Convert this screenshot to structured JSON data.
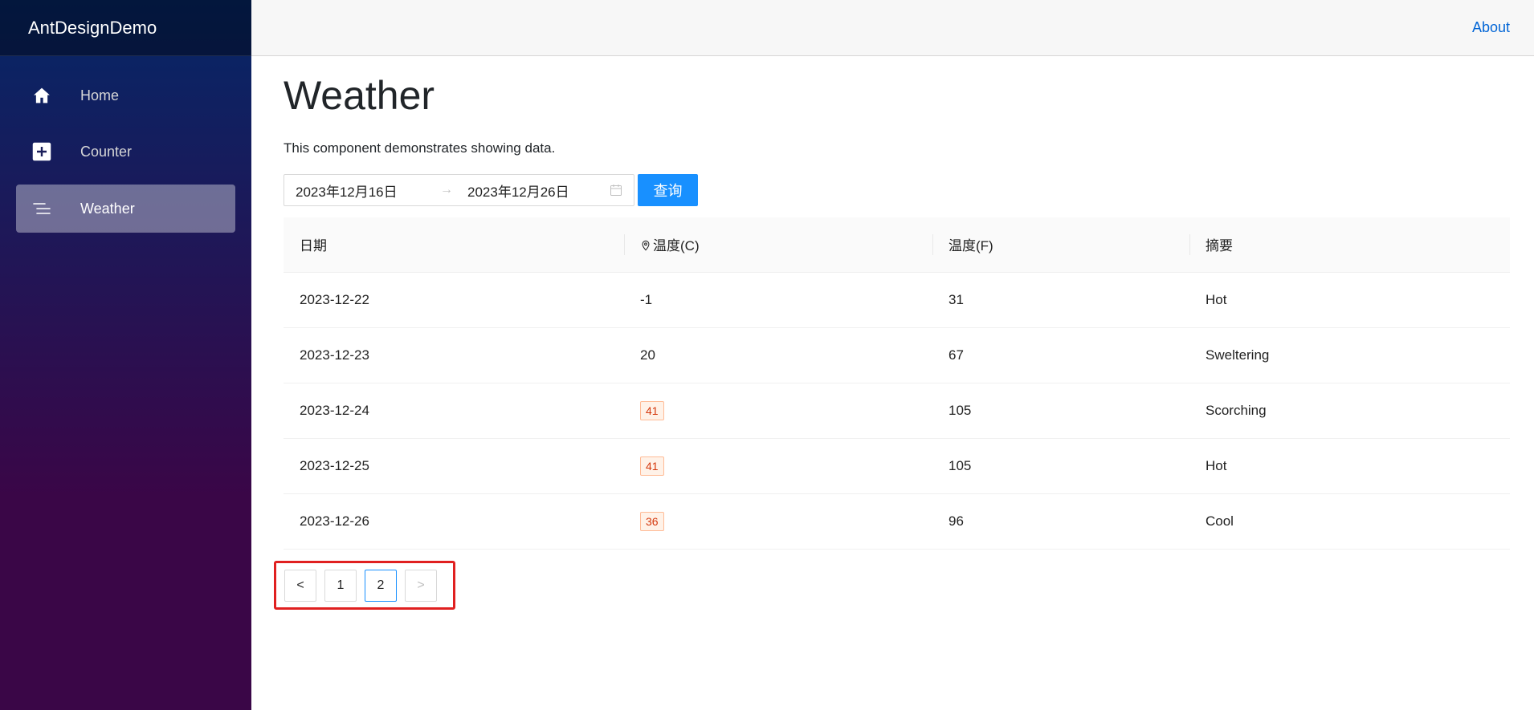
{
  "app": {
    "brand": "AntDesignDemo"
  },
  "sidebar": {
    "items": [
      {
        "label": "Home",
        "icon": "home-icon"
      },
      {
        "label": "Counter",
        "icon": "plus-square-icon"
      },
      {
        "label": "Weather",
        "icon": "menu-lines-icon",
        "active": true
      }
    ]
  },
  "topbar": {
    "about_label": "About"
  },
  "main": {
    "title": "Weather",
    "description": "This component demonstrates showing data.",
    "range_picker": {
      "start": "2023年12月16日",
      "separator": "→",
      "end": "2023年12月26日"
    },
    "query_label": "查询"
  },
  "table": {
    "headers": [
      "日期",
      "温度(C)",
      "温度(F)",
      "摘要"
    ],
    "rows": [
      {
        "date": "2023-12-22",
        "temp_c": "-1",
        "temp_f": "31",
        "summary": "Hot",
        "tagged": false
      },
      {
        "date": "2023-12-23",
        "temp_c": "20",
        "temp_f": "67",
        "summary": "Sweltering",
        "tagged": false
      },
      {
        "date": "2023-12-24",
        "temp_c": "41",
        "temp_f": "105",
        "summary": "Scorching",
        "tagged": true
      },
      {
        "date": "2023-12-25",
        "temp_c": "41",
        "temp_f": "105",
        "summary": "Hot",
        "tagged": true
      },
      {
        "date": "2023-12-26",
        "temp_c": "36",
        "temp_f": "96",
        "summary": "Cool",
        "tagged": true
      }
    ]
  },
  "pagination": {
    "prev": "<",
    "pages": [
      "1",
      "2"
    ],
    "current": "2",
    "next": ">"
  },
  "colors": {
    "primary": "#1890ff",
    "tag_text": "#d4380d",
    "tag_bg": "#fff2e8",
    "tag_border": "#ffbb96",
    "highlight": "#e02020"
  }
}
